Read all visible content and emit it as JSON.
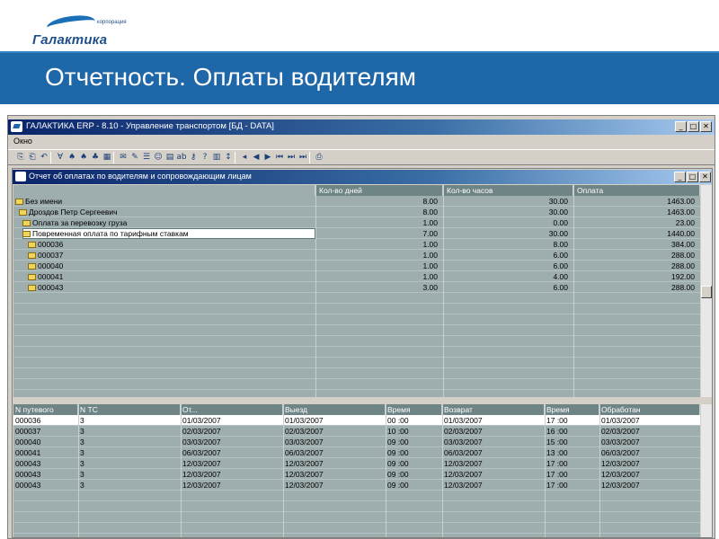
{
  "slide": {
    "logo_small": "корпорация",
    "logo_name": "Галактика",
    "title": "Отчетность. Оплаты водителям"
  },
  "window": {
    "title": "ГАЛАКТИКА ERP - 8.10 - Управление транспортом [БД - DATA]",
    "menu": [
      "Окно"
    ],
    "controls": [
      "_",
      "□",
      "✕"
    ]
  },
  "report": {
    "title": "Отчет об оплатах по водителям и сопровождающим лицам",
    "columns": [
      "Кол-во дней",
      "Кол-во часов",
      "Оплата"
    ],
    "rows": [
      {
        "name": "Без имени",
        "days": "8.00",
        "hours": "30.00",
        "pay": "1463.00"
      },
      {
        "name": "Дроздов Петр Сергеевич",
        "days": "8.00",
        "hours": "30.00",
        "pay": "1463.00"
      },
      {
        "name": "Оплата за перевозку груза",
        "days": "1.00",
        "hours": "0.00",
        "pay": "23.00"
      },
      {
        "name": "Повременная оплата по тарифным ставкам",
        "days": "7.00",
        "hours": "30.00",
        "pay": "1440.00"
      },
      {
        "name": "000036",
        "days": "1.00",
        "hours": "8.00",
        "pay": "384.00"
      },
      {
        "name": "000037",
        "days": "1.00",
        "hours": "6.00",
        "pay": "288.00"
      },
      {
        "name": "000040",
        "days": "1.00",
        "hours": "6.00",
        "pay": "288.00"
      },
      {
        "name": "000041",
        "days": "1.00",
        "hours": "4.00",
        "pay": "192.00"
      },
      {
        "name": "000043",
        "days": "3.00",
        "hours": "6.00",
        "pay": "288.00"
      }
    ]
  },
  "waybills": {
    "columns": [
      "N путевого",
      "N ТС",
      "От...",
      "Выезд",
      "Время",
      "Возврат",
      "Время",
      "Обработан"
    ],
    "rows": [
      [
        "000036",
        "3",
        "01/03/2007",
        "01/03/2007",
        "00 :00",
        "01/03/2007",
        "17 :00",
        "01/03/2007"
      ],
      [
        "000037",
        "3",
        "02/03/2007",
        "02/03/2007",
        "10 :00",
        "02/03/2007",
        "16 :00",
        "02/03/2007"
      ],
      [
        "000040",
        "3",
        "03/03/2007",
        "03/03/2007",
        "09 :00",
        "03/03/2007",
        "15 :00",
        "03/03/2007"
      ],
      [
        "000041",
        "3",
        "06/03/2007",
        "06/03/2007",
        "09 :00",
        "06/03/2007",
        "13 :00",
        "06/03/2007"
      ],
      [
        "000043",
        "3",
        "12/03/2007",
        "12/03/2007",
        "09 :00",
        "12/03/2007",
        "17 :00",
        "12/03/2007"
      ],
      [
        "000043",
        "3",
        "12/03/2007",
        "12/03/2007",
        "09 :00",
        "12/03/2007",
        "17 :00",
        "12/03/2007"
      ],
      [
        "000043",
        "3",
        "12/03/2007",
        "12/03/2007",
        "09 :00",
        "12/03/2007",
        "17 :00",
        "12/03/2007"
      ]
    ]
  },
  "toolbar_icons": [
    "copy-icon",
    "paste-icon",
    "undo-icon",
    "filter-icon",
    "find-icon",
    "find-next-icon",
    "find-prev-icon",
    "mark-icon",
    "open-icon",
    "edit-icon",
    "list-icon",
    "smile-icon",
    "tree-icon",
    "abc-icon",
    "key-icon",
    "help-icon",
    "grid-icon",
    "sort-icon",
    "first-icon",
    "prev-icon",
    "next-icon",
    "skip-back-icon",
    "skip-forward-icon",
    "last-icon",
    "print-icon"
  ],
  "colors": {
    "banner": "#1e67a8",
    "grid_bg": "#9eadad",
    "grid_header": "#6f8484",
    "titlebar": "#0a246a"
  }
}
